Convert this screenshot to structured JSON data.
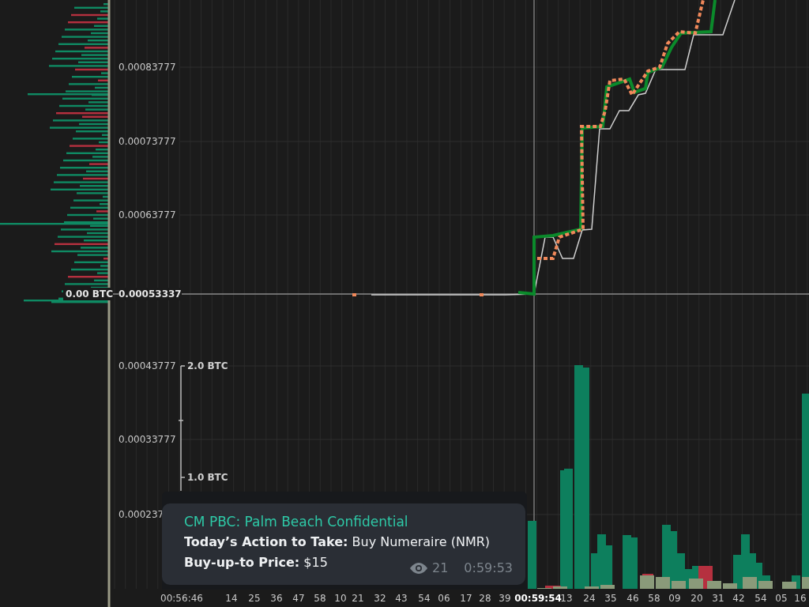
{
  "depth_panel": {
    "total": "0.00 BTC"
  },
  "price_axis": {
    "labels": [
      "0.00083777",
      "0.00073777",
      "0.00063777",
      "0.00043777",
      "0.00033777",
      "0.000237"
    ],
    "current_price": "0.00053337"
  },
  "volume_axis": {
    "labels": [
      "2.0 BTC",
      "1.0 BTC"
    ]
  },
  "time_axis": {
    "labels": [
      {
        "text": "00:56:46",
        "kind": "tick"
      },
      {
        "text": "14",
        "kind": "tick"
      },
      {
        "text": "25",
        "kind": "tick"
      },
      {
        "text": "36",
        "kind": "tick"
      },
      {
        "text": "47",
        "kind": "tick"
      },
      {
        "text": "58",
        "kind": "tick"
      },
      {
        "text": "10",
        "kind": "tick"
      },
      {
        "text": "21",
        "kind": "tick"
      },
      {
        "text": "32",
        "kind": "tick"
      },
      {
        "text": "43",
        "kind": "tick"
      },
      {
        "text": "54",
        "kind": "tick"
      },
      {
        "text": "06",
        "kind": "tick"
      },
      {
        "text": "17",
        "kind": "tick"
      },
      {
        "text": "28",
        "kind": "tick"
      },
      {
        "text": "39",
        "kind": "tick"
      },
      {
        "text": "00:59:54",
        "kind": "current"
      },
      {
        "text": "13",
        "kind": "tick"
      },
      {
        "text": "24",
        "kind": "tick"
      },
      {
        "text": "35",
        "kind": "tick"
      },
      {
        "text": "46",
        "kind": "tick"
      },
      {
        "text": "58",
        "kind": "tick"
      },
      {
        "text": "09",
        "kind": "tick"
      },
      {
        "text": "20",
        "kind": "tick"
      },
      {
        "text": "31",
        "kind": "tick"
      },
      {
        "text": "42",
        "kind": "tick"
      },
      {
        "text": "54",
        "kind": "tick"
      },
      {
        "text": "05",
        "kind": "tick"
      },
      {
        "text": "16",
        "kind": "tick"
      }
    ]
  },
  "message": {
    "channel": "CM PBC: Palm Beach Confidential",
    "lines": [
      "**Today’s Action to Take:** Buy Numeraire (NMR)",
      "**Buy-up-to Price:** $15"
    ],
    "views": "21",
    "time": "0:59:53"
  }
}
